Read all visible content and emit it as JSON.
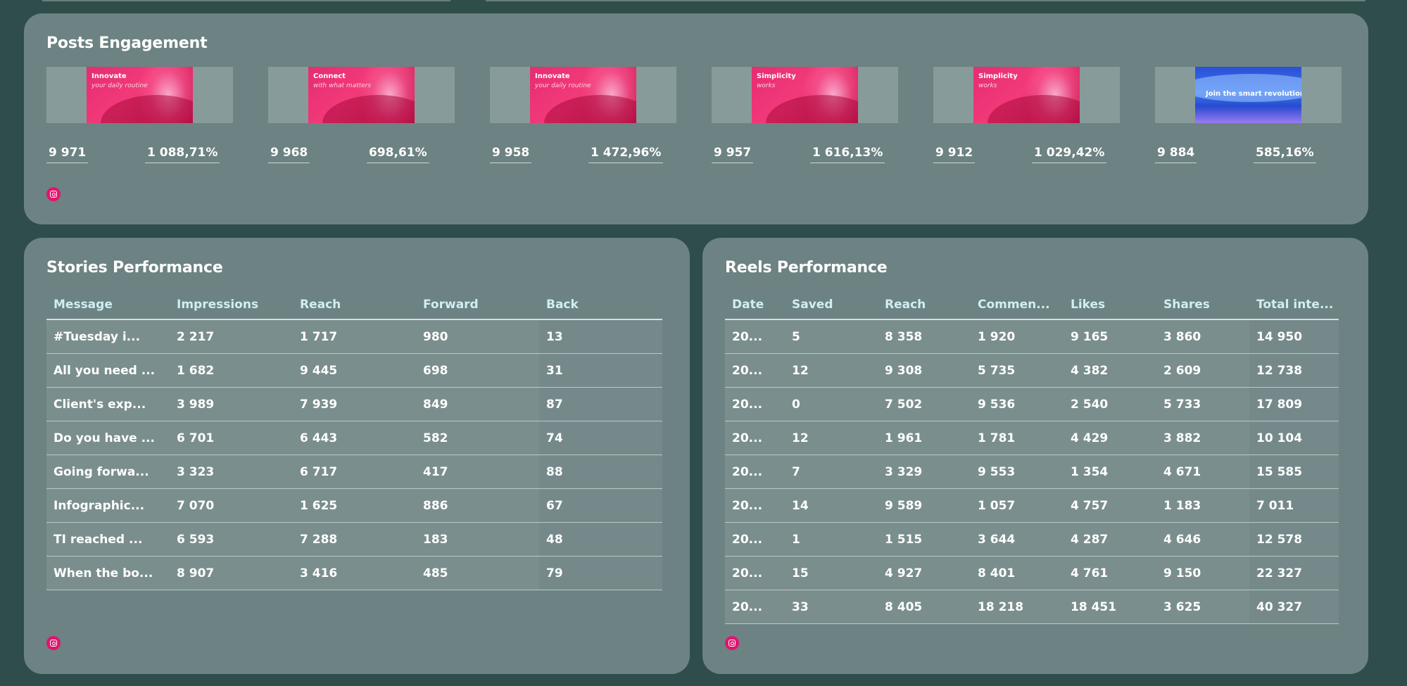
{
  "posts_engagement": {
    "title": "Posts Engagement",
    "posts": [
      {
        "thumb_line1": "Innovate",
        "thumb_line2": "your daily routine",
        "thumb_style": "pink",
        "metric_a": "9 971",
        "metric_b": "1 088,71%"
      },
      {
        "thumb_line1": "Connect",
        "thumb_line2": "with what matters",
        "thumb_style": "pink",
        "metric_a": "9 968",
        "metric_b": "698,61%"
      },
      {
        "thumb_line1": "Innovate",
        "thumb_line2": "your daily routine",
        "thumb_style": "pink",
        "metric_a": "9 958",
        "metric_b": "1 472,96%"
      },
      {
        "thumb_line1": "Simplicity",
        "thumb_line2": "works",
        "thumb_style": "pink",
        "metric_a": "9 957",
        "metric_b": "1 616,13%"
      },
      {
        "thumb_line1": "Simplicity",
        "thumb_line2": "works",
        "thumb_style": "pink",
        "metric_a": "9 912",
        "metric_b": "1 029,42%"
      },
      {
        "thumb_line1": "Join the smart revolution",
        "thumb_line2": "",
        "thumb_style": "blue",
        "metric_a": "9 884",
        "metric_b": "585,16%"
      }
    ],
    "source_icon": "instagram-icon",
    "accent_color": "#e0156e"
  },
  "stories_performance": {
    "title": "Stories Performance",
    "columns": [
      "Message",
      "Impressions",
      "Reach",
      "Forward",
      "Back"
    ],
    "rows": [
      [
        "#Tuesday i...",
        "2 217",
        "1 717",
        "980",
        "13"
      ],
      [
        "All you need ...",
        "1 682",
        "9 445",
        "698",
        "31"
      ],
      [
        "Client's exp...",
        "3 989",
        "7 939",
        "849",
        "87"
      ],
      [
        "Do you have ...",
        "6 701",
        "6 443",
        "582",
        "74"
      ],
      [
        "Going forwa...",
        "3 323",
        "6 717",
        "417",
        "88"
      ],
      [
        "Infographic...",
        "7 070",
        "1 625",
        "886",
        "67"
      ],
      [
        "TI reached ...",
        "6 593",
        "7 288",
        "183",
        "48"
      ],
      [
        "When the bo...",
        "8 907",
        "3 416",
        "485",
        "79"
      ]
    ],
    "source_icon": "instagram-icon"
  },
  "reels_performance": {
    "title": "Reels Performance",
    "columns": [
      "Date",
      "Saved",
      "Reach",
      "Commen...",
      "Likes",
      "Shares",
      "Total inte..."
    ],
    "rows": [
      [
        "20...",
        "5",
        "8 358",
        "1 920",
        "9 165",
        "3 860",
        "14 950"
      ],
      [
        "20...",
        "12",
        "9 308",
        "5 735",
        "4 382",
        "2 609",
        "12 738"
      ],
      [
        "20...",
        "0",
        "7 502",
        "9 536",
        "2 540",
        "5 733",
        "17 809"
      ],
      [
        "20...",
        "12",
        "1 961",
        "1 781",
        "4 429",
        "3 882",
        "10 104"
      ],
      [
        "20...",
        "7",
        "3 329",
        "9 553",
        "1 354",
        "4 671",
        "15 585"
      ],
      [
        "20...",
        "14",
        "9 589",
        "1 057",
        "4 757",
        "1 183",
        "7 011"
      ],
      [
        "20...",
        "1",
        "1 515",
        "3 644",
        "4 287",
        "4 646",
        "12 578"
      ],
      [
        "20...",
        "15",
        "4 927",
        "8 401",
        "4 761",
        "9 150",
        "22 327"
      ],
      [
        "20...",
        "33",
        "8 405",
        "18 218",
        "18 451",
        "3 625",
        "40 327"
      ]
    ],
    "source_icon": "instagram-icon"
  },
  "colors": {
    "page_background": "#2e4d4b",
    "card_background": "#6d8282",
    "header_text": "#cfeff0",
    "brand_pink": "#e0156e"
  }
}
